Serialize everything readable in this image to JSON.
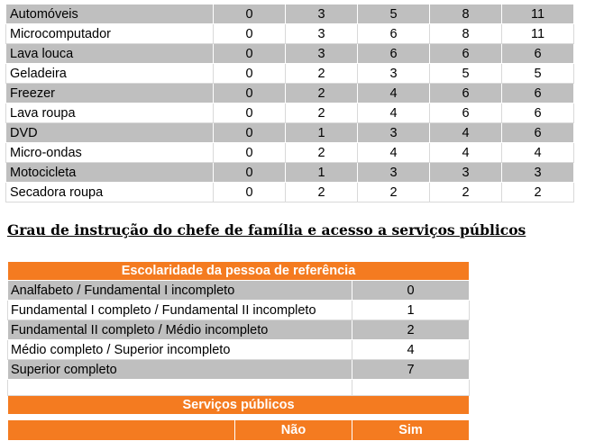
{
  "items_table": {
    "rows": [
      {
        "label": "Automóveis",
        "values": [
          "0",
          "3",
          "5",
          "8",
          "11"
        ]
      },
      {
        "label": "Microcomputador",
        "values": [
          "0",
          "3",
          "6",
          "8",
          "11"
        ]
      },
      {
        "label": "Lava louca",
        "values": [
          "0",
          "3",
          "6",
          "6",
          "6"
        ]
      },
      {
        "label": "Geladeira",
        "values": [
          "0",
          "2",
          "3",
          "5",
          "5"
        ]
      },
      {
        "label": "Freezer",
        "values": [
          "0",
          "2",
          "4",
          "6",
          "6"
        ]
      },
      {
        "label": "Lava roupa",
        "values": [
          "0",
          "2",
          "4",
          "6",
          "6"
        ]
      },
      {
        "label": "DVD",
        "values": [
          "0",
          "1",
          "3",
          "4",
          "6"
        ]
      },
      {
        "label": "Micro-ondas",
        "values": [
          "0",
          "2",
          "4",
          "4",
          "4"
        ]
      },
      {
        "label": "Motocicleta",
        "values": [
          "0",
          "1",
          "3",
          "3",
          "3"
        ]
      },
      {
        "label": "Secadora roupa",
        "values": [
          "0",
          "2",
          "2",
          "2",
          "2"
        ]
      }
    ]
  },
  "section_heading": "Grau de instrução do chefe de família e acesso a serviços públicos",
  "education_table": {
    "header": "Escolaridade da pessoa de referência",
    "rows": [
      {
        "label": "Analfabeto / Fundamental I incompleto",
        "value": "0"
      },
      {
        "label": "Fundamental I completo / Fundamental II incompleto",
        "value": "1"
      },
      {
        "label": "Fundamental II completo / Médio incompleto",
        "value": "2"
      },
      {
        "label": "Médio completo / Superior incompleto",
        "value": "4"
      },
      {
        "label": "Superior completo",
        "value": "7"
      }
    ],
    "services_header": "Serviços públicos",
    "services_columns": [
      "Não",
      "Sim"
    ]
  }
}
